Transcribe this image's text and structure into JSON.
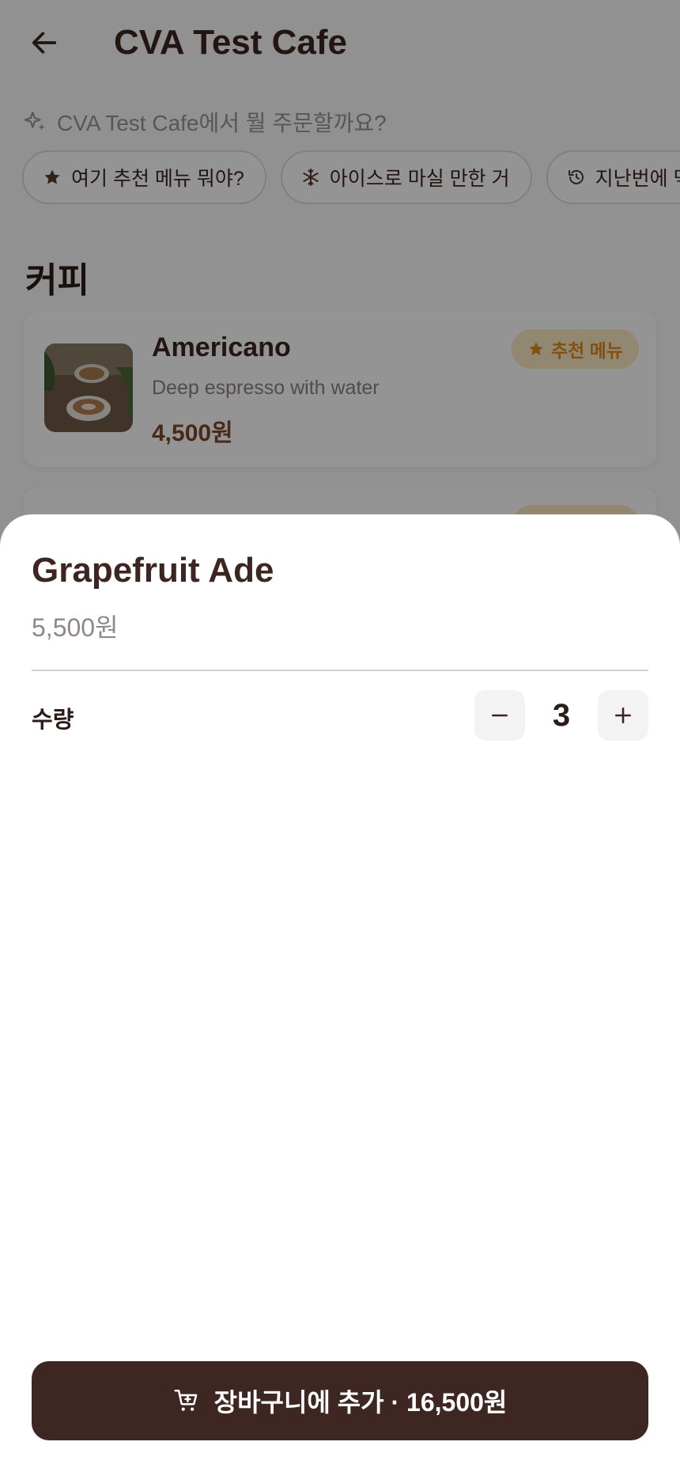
{
  "header": {
    "title": "CVA Test Cafe"
  },
  "assistant": {
    "prompt": "CVA Test Cafe에서 뭘 주문할까요?",
    "chips": [
      {
        "label": "여기 추천 메뉴 뭐야?",
        "icon": "star-icon"
      },
      {
        "label": "아이스로 마실 만한 거",
        "icon": "snowflake-icon"
      },
      {
        "label": "지난번에 먹은 거",
        "icon": "history-icon"
      }
    ]
  },
  "section": {
    "title": "커피"
  },
  "menu": [
    {
      "name": "Americano",
      "desc": "Deep espresso with water",
      "price": "4,500원",
      "badge": "추천 메뉴"
    },
    {
      "name": "",
      "desc": "",
      "price": "",
      "badge": ""
    }
  ],
  "sheet": {
    "title": "Grapefruit Ade",
    "price": "5,500원",
    "qty_label": "수량",
    "qty_value": "3",
    "add_label": "장바구니에 추가 · 16,500원"
  },
  "colors": {
    "brand": "#3e2622",
    "accent": "#e08a1e",
    "badge_bg": "#fbe9c2"
  }
}
